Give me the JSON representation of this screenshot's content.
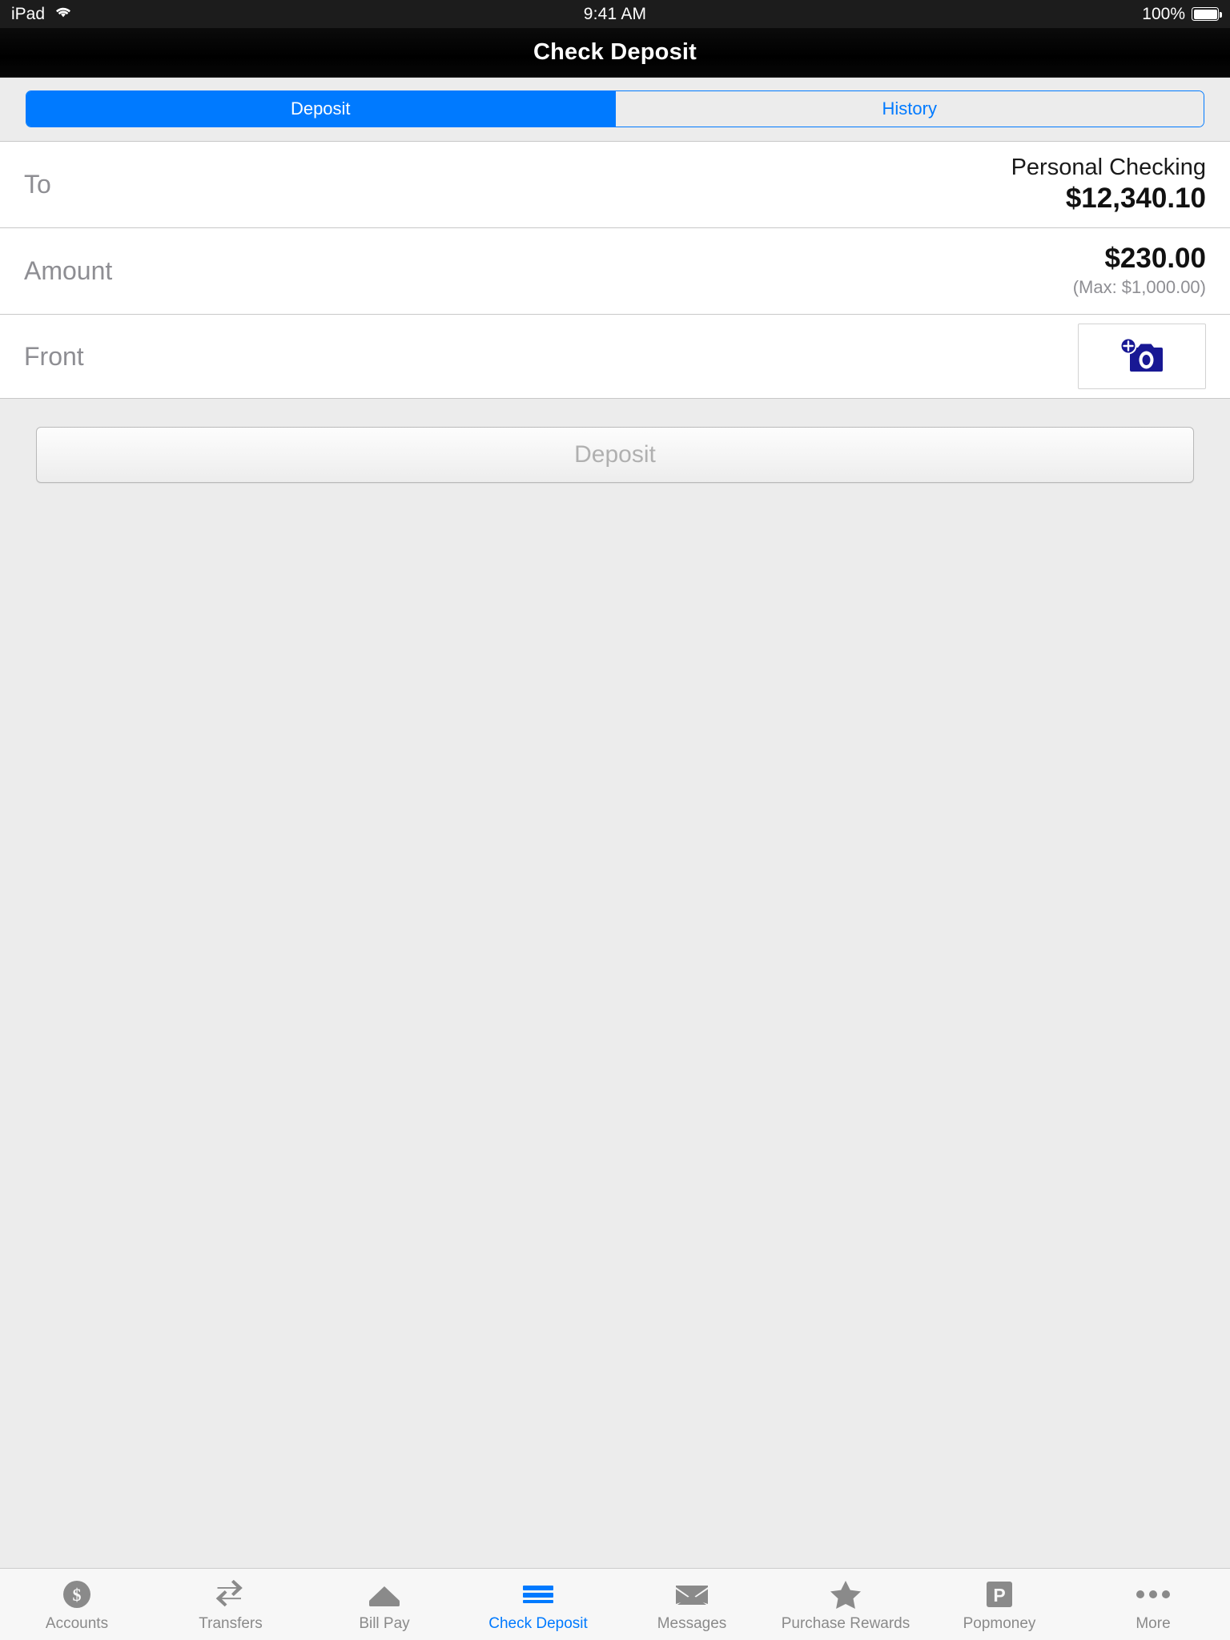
{
  "status_bar": {
    "device": "iPad",
    "wifi_icon": "wifi-icon",
    "time": "9:41 AM",
    "battery_percent": "100%",
    "battery_icon": "battery-full-icon"
  },
  "nav": {
    "title": "Check Deposit"
  },
  "segmented_control": {
    "items": [
      {
        "label": "Deposit",
        "active": true
      },
      {
        "label": "History",
        "active": false
      }
    ],
    "accent_color": "#007aff"
  },
  "form": {
    "to": {
      "label": "To",
      "account_name": "Personal Checking",
      "balance": "$12,340.10"
    },
    "amount": {
      "label": "Amount",
      "value": "$230.00",
      "max_note": "(Max: $1,000.00)"
    },
    "front": {
      "label": "Front",
      "camera_button_icon": "camera-add-icon",
      "camera_icon_color": "#1a１a8c"
    }
  },
  "actions": {
    "deposit_button": "Deposit"
  },
  "tab_bar": {
    "items": [
      {
        "label": "Accounts",
        "icon": "dollar-circle-icon",
        "active": false
      },
      {
        "label": "Transfers",
        "icon": "transfer-arrows-icon",
        "active": false
      },
      {
        "label": "Bill Pay",
        "icon": "envelope-stack-icon",
        "active": false
      },
      {
        "label": "Check Deposit",
        "icon": "check-lines-icon",
        "active": true
      },
      {
        "label": "Messages",
        "icon": "envelope-icon",
        "active": false
      },
      {
        "label": "Purchase Rewards",
        "icon": "star-icon",
        "active": false
      },
      {
        "label": "Popmoney",
        "icon": "popmoney-p-icon",
        "active": false
      },
      {
        "label": "More",
        "icon": "ellipsis-icon",
        "active": false
      }
    ],
    "active_color": "#007aff",
    "inactive_color": "#8a8a8a"
  }
}
